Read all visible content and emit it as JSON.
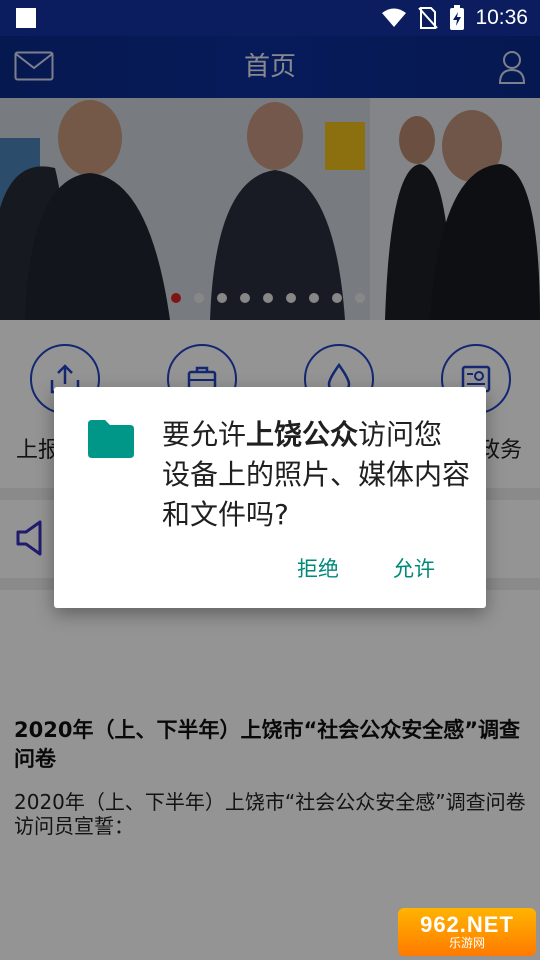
{
  "status_bar": {
    "time": "10:36"
  },
  "header": {
    "title": "首页"
  },
  "banner": {
    "slide_count": 9,
    "active_index": 0
  },
  "actions": [
    {
      "label": "上报",
      "icon": "upload-tray-icon"
    },
    {
      "label": "",
      "icon": "briefcase-icon"
    },
    {
      "label": "",
      "icon": "water-drop-icon"
    },
    {
      "label": "政务",
      "icon": "news-icon"
    }
  ],
  "article": {
    "title": "2020年（上、下半年）上饶市“社会公众安全感”调查问卷",
    "body_line1": "2020年（上、下半年）上饶市“社会公众安全感”调查问卷",
    "body_line2": "访问员宣誓："
  },
  "dialog": {
    "message_prefix": "要允许",
    "app_name": "上饶公众",
    "message_suffix": "访问您设备上的照片、媒体内容和文件吗?",
    "deny_label": "拒绝",
    "allow_label": "允许"
  },
  "watermark": {
    "top": "962.NET",
    "bottom": "乐游网"
  },
  "colors": {
    "header": "#0d2f9c",
    "accent_blue": "#2244c4",
    "dialog_button": "#00897b",
    "folder_icon": "#009688"
  }
}
